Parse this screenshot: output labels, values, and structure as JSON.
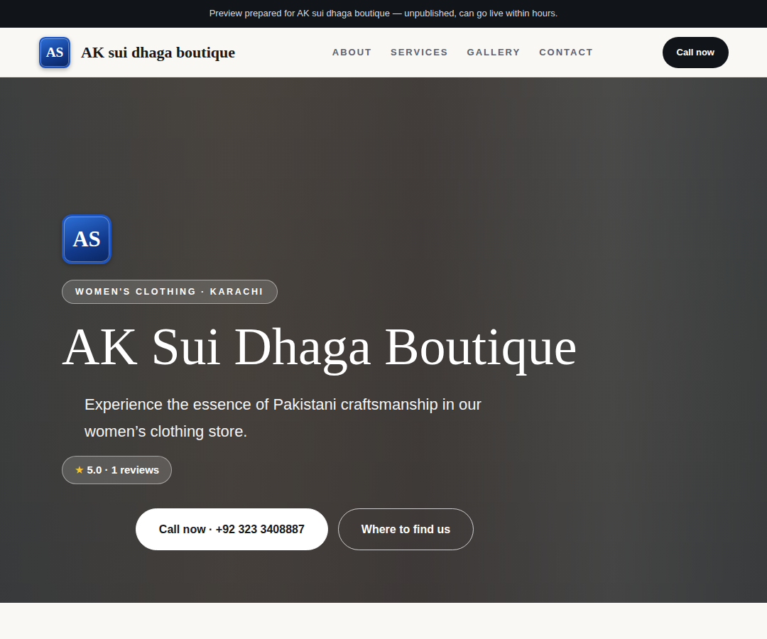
{
  "banner": "Preview prepared for AK sui dhaga boutique — unpublished, can go live within hours.",
  "header": {
    "logo": "AS",
    "brand": "AK sui dhaga boutique",
    "nav": [
      "ABOUT",
      "SERVICES",
      "GALLERY",
      "CONTACT"
    ],
    "cta": "Call now"
  },
  "hero": {
    "logo": "AS",
    "badge": "WOMEN'S CLOTHING · KARACHI",
    "title": "AK Sui Dhaga Boutique",
    "subtitle": "Experience the essence of Pakistani craftsmanship in our women’s clothing store.",
    "rating": {
      "star": "★",
      "text": "5.0 · 1 reviews"
    },
    "buttons": [
      {
        "label": "Call now · +92 323 3408887",
        "kind": "primary"
      },
      {
        "label": "Where to find us",
        "kind": "outline"
      }
    ]
  }
}
